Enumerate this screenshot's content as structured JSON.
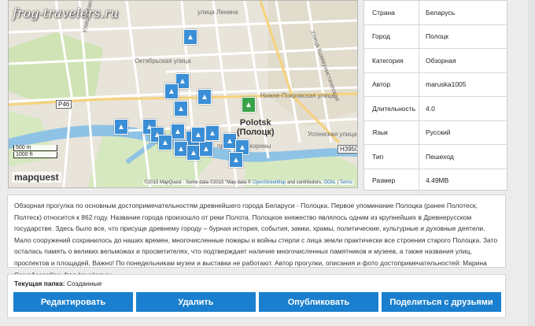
{
  "map": {
    "watermark": "frog-travelers.ru",
    "city_label_1": "Polotsk",
    "city_label_2": "(Полоцк)",
    "road_badge_1": "P46",
    "road_badge_2": "H3950",
    "scale_m": "500 m",
    "scale_ft": "1000 ft",
    "brand": "mapquest",
    "attribution_prefix": "©2015 MapQuest · Some data ©2015 \"Map data ©",
    "attribution_link1": "OpenStreetMap",
    "attribution_mid": "and contributors,",
    "attribution_link2": "ODbL",
    "attribution_sep": "|",
    "attribution_link3": "Terms",
    "street_labels": [
      "Улица Максима Богдановича",
      "улица Ленина",
      "Октябрьская улица",
      "Улица Коммунистическая",
      "Нижне-Покровская улица",
      "проспект Скорины",
      "Успенская улица",
      "Октябрьская улица"
    ],
    "pin_colors": {
      "blue": "#3b8fd6",
      "green": "#3aa34a"
    }
  },
  "info": {
    "rows": [
      {
        "key": "Страна",
        "value": "Беларусь"
      },
      {
        "key": "Город",
        "value": "Полоцк"
      },
      {
        "key": "Категория",
        "value": "Обзорная"
      },
      {
        "key": "Автор",
        "value": "maruska1005"
      },
      {
        "key": "Длительность",
        "value": "4.0"
      },
      {
        "key": "Язык",
        "value": "Русский"
      },
      {
        "key": "Тип",
        "value": "Пешеход"
      },
      {
        "key": "Размер",
        "value": "4.49MB"
      }
    ]
  },
  "description": {
    "text": "Обзорная прогулка по основным достопримечательностям древнейшего города Беларуси - Полоцка. Первое упоминание Полоцка (ранее Полотеск, Полтеск) относится к 862 году. Название города произошло от реки Полота. Полоцкое княжество являлось одним из крупнейших в Древнерусском государстве. Здесь было все, что присуще древнему городу – бурная история, события, замки, храмы, политические, культурные и духовные деятели. Мало сооружений сохранилось до наших времен, многочисленные пожары и войны стерли с лица земли практически все строения старого Полоцка. Зато осталась память о великих вельможах и просветителях, что подтверждает наличие многочисленных памятников и музеев, а также названия улиц, проспектов и площадей. Важно! По понедельникам музеи и выставки не работают. Автор прогулки, описания и фото достопримечательностей: Марина СамоAccording, frog-travelers.ru."
  },
  "folder": {
    "label": "Текущая папка:",
    "value": "Созданные"
  },
  "buttons": {
    "edit": "Редактировать",
    "delete": "Удалить",
    "publish": "Опубликовать",
    "share": "Поделиться с друзьями"
  },
  "colors": {
    "button": "#1a7fce",
    "page_bg": "#ececec",
    "river": "#8fc3e6"
  }
}
